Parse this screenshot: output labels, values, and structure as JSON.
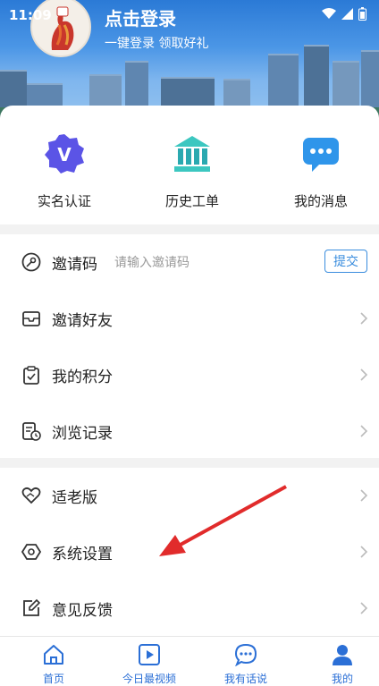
{
  "status": {
    "time": "11:09"
  },
  "header": {
    "login_title": "点击登录",
    "login_sub": "一键登录  领取好礼"
  },
  "quick": [
    {
      "label": "实名认证",
      "icon": "verified-v-icon"
    },
    {
      "label": "历史工单",
      "icon": "bank-building-icon"
    },
    {
      "label": "我的消息",
      "icon": "message-bubble-icon"
    }
  ],
  "invite": {
    "label": "邀请码",
    "placeholder": "请输入邀请码",
    "submit": "提交"
  },
  "menu1": [
    {
      "label": "邀请好友"
    },
    {
      "label": "我的积分"
    },
    {
      "label": "浏览记录"
    }
  ],
  "menu2": [
    {
      "label": "适老版"
    },
    {
      "label": "系统设置"
    },
    {
      "label": "意见反馈"
    }
  ],
  "tabs": [
    {
      "label": "首页"
    },
    {
      "label": "今日最视频"
    },
    {
      "label": "我有话说"
    },
    {
      "label": "我的"
    }
  ],
  "colors": {
    "accent": "#2b6fd6",
    "arrow": "#e12b2b"
  }
}
